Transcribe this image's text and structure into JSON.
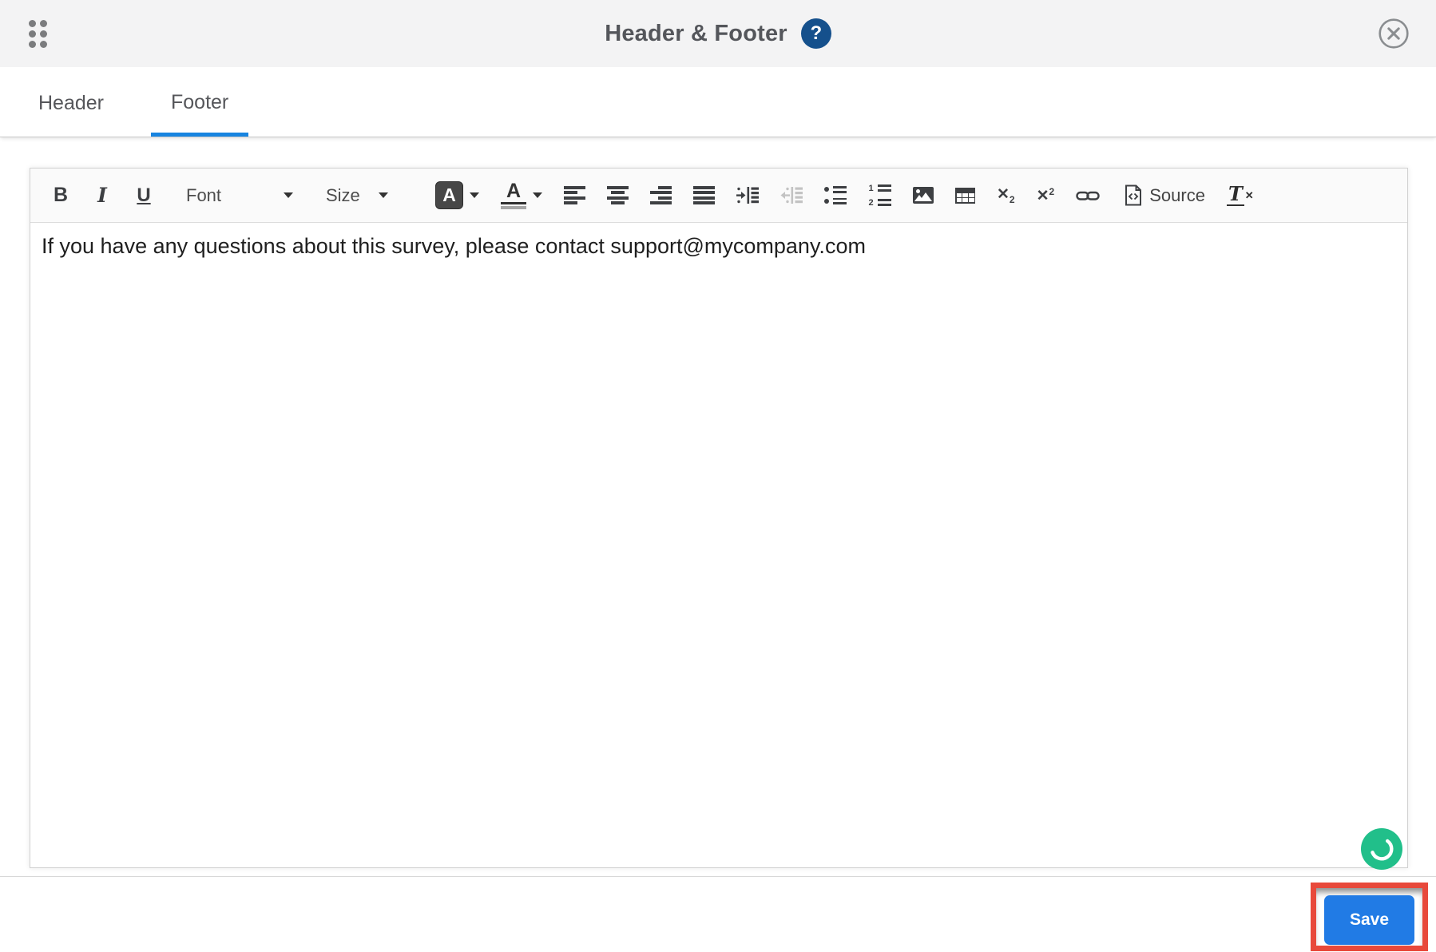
{
  "modal": {
    "title": "Header & Footer",
    "help_glyph": "?"
  },
  "tabs": [
    {
      "label": "Header",
      "active": false
    },
    {
      "label": "Footer",
      "active": true
    }
  ],
  "toolbar": {
    "bold": "B",
    "italic": "I",
    "underline": "U",
    "font_placeholder": "Font",
    "size_placeholder": "Size",
    "text_color_letter": "A",
    "bg_color_letter": "A",
    "numbered_list_digits": [
      "1",
      "2"
    ],
    "subscript_base": "✕",
    "subscript_digit": "2",
    "superscript_base": "✕",
    "superscript_digit": "2",
    "source_label": "Source",
    "remove_format_letter": "T",
    "remove_format_x": "✕"
  },
  "editor": {
    "content": "If you have any questions about this survey, please contact support@mycompany.com"
  },
  "footer": {
    "save_label": "Save"
  },
  "colors": {
    "active_tab_blue": "#1784e0",
    "save_blue": "#217be5",
    "help_blue": "#15508c",
    "highlight_red": "#e8493b",
    "smiley_green": "#21bf8a",
    "topbar_gray": "#f3f3f4"
  }
}
